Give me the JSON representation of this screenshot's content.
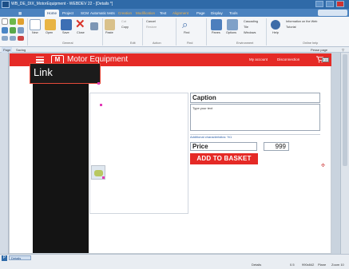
{
  "window": {
    "title": "WB_DE_DIX_MotorEquipment - WEBDEV 22 - [Details *]",
    "controls": [
      "minimize-icon",
      "maximize-icon",
      "close-icon"
    ]
  },
  "menu": {
    "tabs": [
      {
        "label": "Home",
        "active": true
      },
      {
        "label": "Project"
      },
      {
        "label": "SCM"
      },
      {
        "label": "Automatic tests"
      },
      {
        "label": "Creation",
        "accent": "orange"
      },
      {
        "label": "Modification",
        "accent": "orange"
      },
      {
        "label": "Text"
      },
      {
        "label": "Alignment",
        "accent": "orange"
      },
      {
        "label": "Page"
      },
      {
        "label": "Display"
      },
      {
        "label": "Tools"
      }
    ]
  },
  "ribbon": {
    "buttons": {
      "new": "New",
      "open": "Open",
      "save": "Save",
      "close": "Close",
      "paste": "Paste",
      "cut": "Cut",
      "copy": "Copy",
      "cancel": "Cancel",
      "restore": "Restore",
      "find": "Find",
      "panes": "Panes",
      "options": "Options",
      "cascading": "Cascading",
      "tile": "Tile",
      "windows": "Windows",
      "help": "Help",
      "info": "Information on the Web",
      "tutorial": "Tutorial"
    },
    "groups": [
      "General",
      "Edit",
      "Action",
      "Find",
      "Environment",
      "Online help"
    ],
    "search_placeholder": "Pesse page"
  },
  "subbar": {
    "tabs": [
      "Page",
      "Saving"
    ]
  },
  "page": {
    "colors": {
      "brand": "#e52a26",
      "sidebar": "#141414"
    },
    "header": {
      "brand": "Motor Equipment",
      "my_account": "My account",
      "disconnection": "Disconnection",
      "mini_label": "0 (x)"
    },
    "link_label": "Link",
    "caption": "Caption",
    "type_text": "Type your text",
    "additional": "Additional characteristics: %1",
    "price_label": "Price",
    "price_value": "999",
    "add_button": "ADD TO BASKET"
  },
  "statusbar": {
    "tab": "Details",
    "details": "Details",
    "zoom": "0.5",
    "coords": "990x842",
    "mode": "Plane",
    "zoom_label": "Zoom 10"
  }
}
